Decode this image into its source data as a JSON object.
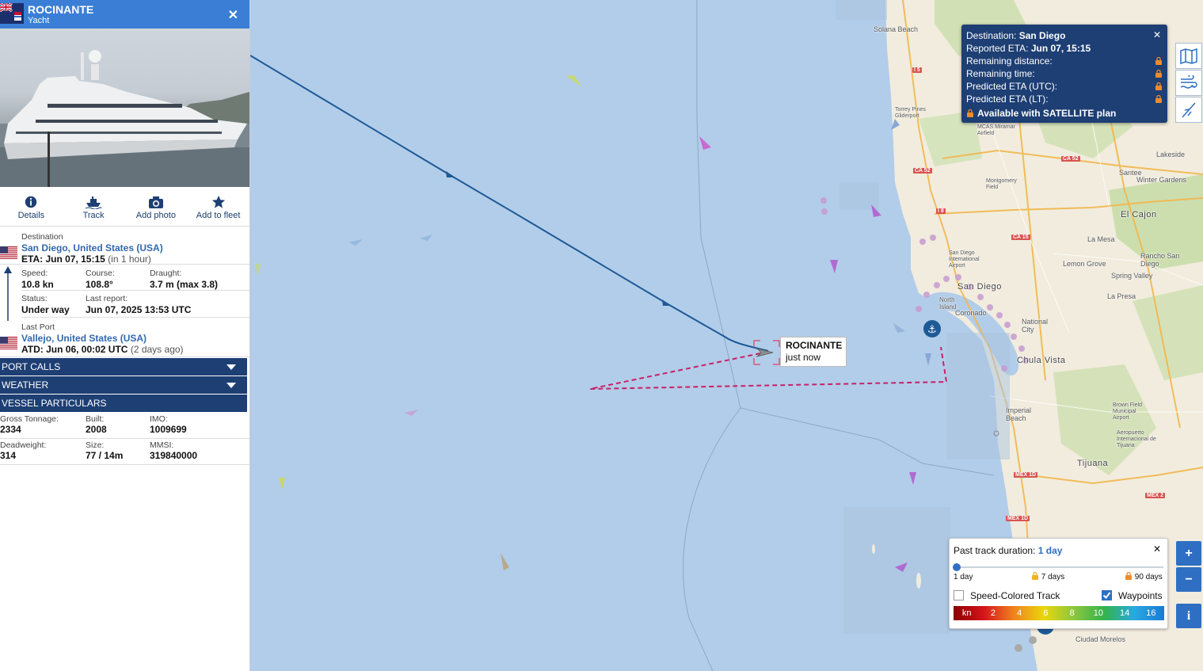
{
  "vessel": {
    "name": "ROCINANTE",
    "type": "Yacht",
    "map_label_time": "just now"
  },
  "actions": [
    {
      "label": "Details",
      "icon": "info-icon"
    },
    {
      "label": "Track",
      "icon": "ship-icon"
    },
    {
      "label": "Add photo",
      "icon": "camera-icon"
    },
    {
      "label": "Add to fleet",
      "icon": "star-icon"
    }
  ],
  "voyage": {
    "destination_label": "Destination",
    "destination": "San Diego, United States (USA)",
    "eta_prefix": "ETA: Jun 07, 15:15",
    "eta_rel": "(in 1 hour)",
    "speed_label": "Speed:",
    "speed": "10.8 kn",
    "course_label": "Course:",
    "course": "108.8°",
    "draught_label": "Draught:",
    "draught": "3.7 m (max 3.8)",
    "status_label": "Status:",
    "status": "Under way",
    "last_report_label": "Last report:",
    "last_report": "Jun 07, 2025 13:53 UTC",
    "last_port_label": "Last Port",
    "last_port": "Vallejo, United States (USA)",
    "atd_prefix": "ATD: Jun 06, 00:02 UTC",
    "atd_rel": "(2 days ago)"
  },
  "sections": {
    "port_calls": "PORT CALLS",
    "weather": "WEATHER",
    "particulars": "VESSEL PARTICULARS"
  },
  "particulars": {
    "gt_label": "Gross Tonnage:",
    "gt": "2334",
    "built_label": "Built:",
    "built": "2008",
    "imo_label": "IMO:",
    "imo": "1009699",
    "dwt_label": "Deadweight:",
    "dwt": "314",
    "size_label": "Size:",
    "size": "77 / 14m",
    "mmsi_label": "MMSI:",
    "mmsi": "319840000"
  },
  "destination_popup": {
    "dest_label": "Destination:",
    "dest": "San Diego",
    "reported_eta_label": "Reported ETA:",
    "reported_eta": "Jun 07, 15:15",
    "remaining_distance": "Remaining distance:",
    "remaining_time": "Remaining time:",
    "predicted_eta_utc": "Predicted ETA (UTC):",
    "predicted_eta_lt": "Predicted ETA (LT):",
    "satellite": "Available with SATELLITE plan"
  },
  "track_panel": {
    "title": "Past track duration:",
    "value": "1 day",
    "stops": [
      "1 day",
      "7 days",
      "90 days"
    ],
    "speed_colored": "Speed-Colored Track",
    "speed_colored_checked": false,
    "waypoints": "Waypoints",
    "waypoints_checked": true,
    "legend": [
      "kn",
      "2",
      "4",
      "6",
      "8",
      "10",
      "14",
      "16"
    ],
    "legend_colors": [
      "#8b0000",
      "#d4141b",
      "#f0821e",
      "#e9d70c",
      "#8cc63f",
      "#34b44a",
      "#28a9e0",
      "#1a7bd6"
    ]
  },
  "map_places": {
    "san_diego": "San Diego",
    "chula_vista": "Chula Vista",
    "tijuana": "Tijuana",
    "el_cajon": "El Cajon",
    "national_city": "National City",
    "coronado": "Coronado",
    "imperial_beach": "Imperial Beach",
    "la_mesa": "La Mesa",
    "lemon_grove": "Lemon Grove",
    "spring_valley": "Spring Valley",
    "la_presa": "La Presa",
    "santee": "Santee",
    "winter_gardens": "Winter Gardens",
    "lakeside": "Lakeside",
    "solana_beach": "Solana Beach",
    "rancho_san_diego": "Rancho San Diego",
    "ciudad_morelos": "Ciudad Morelos",
    "torrey_pines": "Torrey Pines Gliderport",
    "mcas": "MCAS Miramar Airfield",
    "montgomery": "Montgomery Field",
    "sd_airport": "San Diego International Airport",
    "north_island": "North Island",
    "brown_field": "Brown Field Municipal Airport",
    "tijuana_airport": "Aeropuerto Internacional de Tijuana"
  },
  "road_badges": [
    "I 5",
    "CA 52",
    "CA 52",
    "I 8",
    "CA 15",
    "MEX 1D",
    "MEX 1D",
    "MEX 2"
  ]
}
